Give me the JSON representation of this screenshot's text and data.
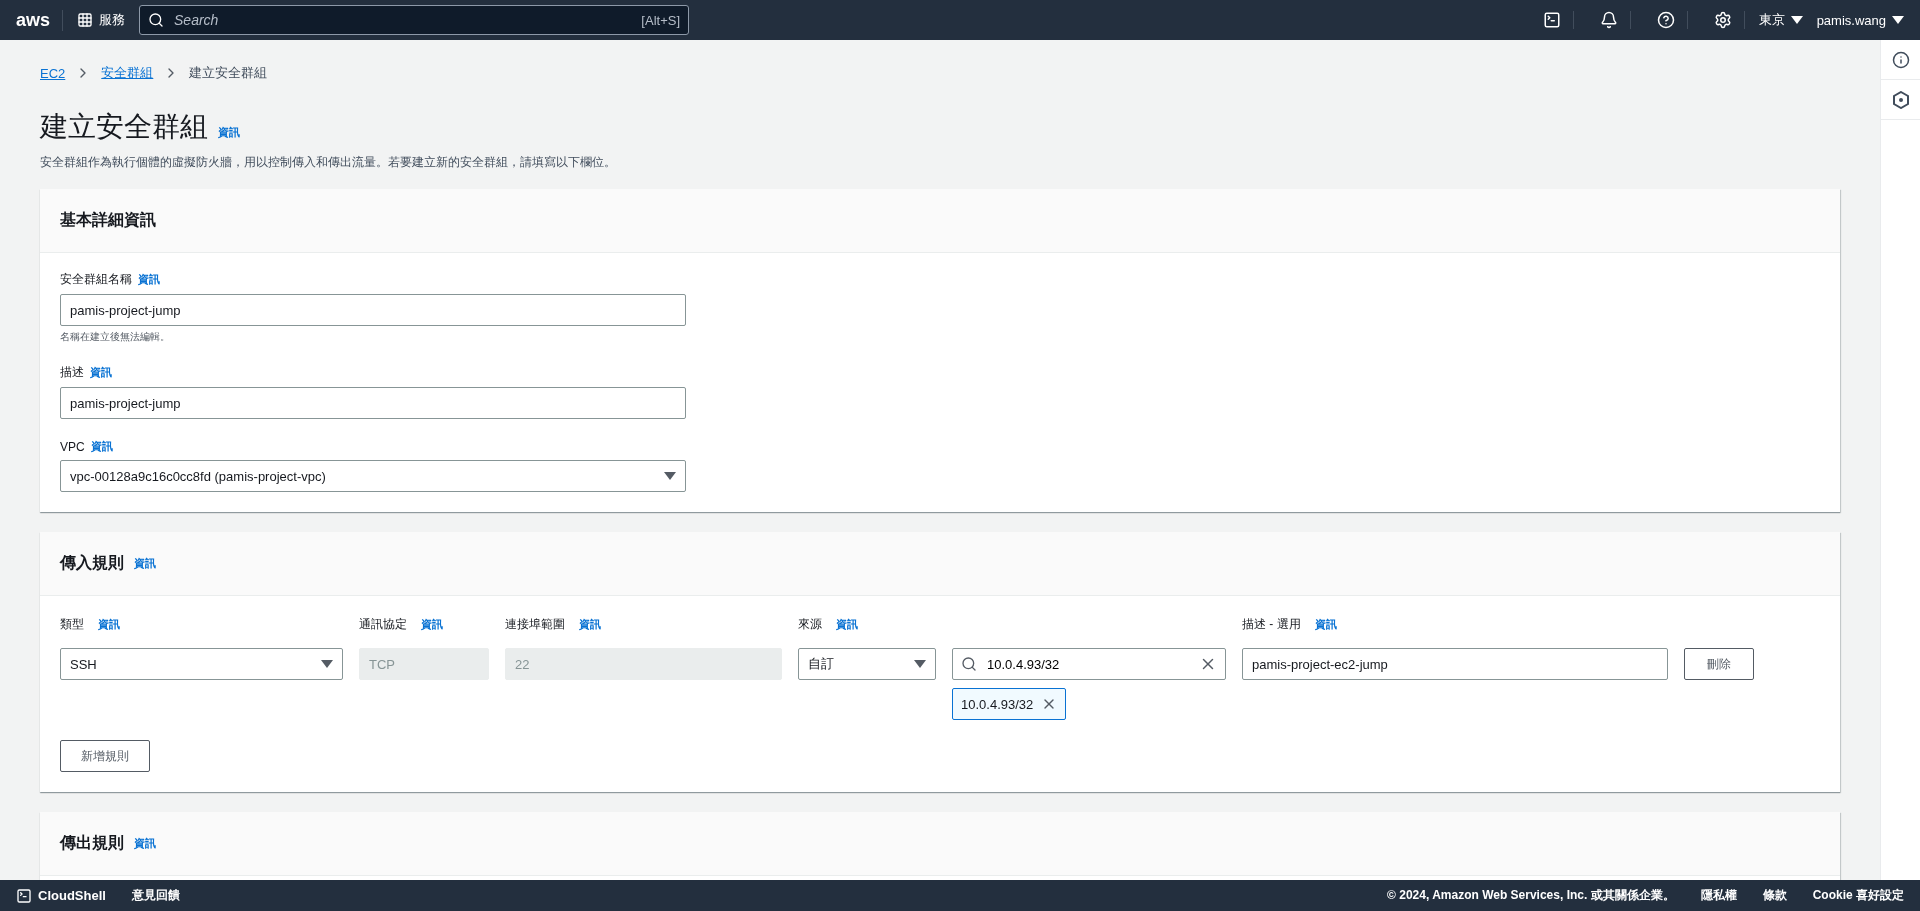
{
  "top_nav": {
    "logo": "aws",
    "services": "服務",
    "search_placeholder": "Search",
    "search_shortcut": "[Alt+S]",
    "region": "東京",
    "user": "pamis.wang"
  },
  "breadcrumbs": [
    {
      "label": "EC2",
      "link": true
    },
    {
      "label": "安全群組",
      "link": true
    },
    {
      "label": "建立安全群組",
      "link": false
    }
  ],
  "page": {
    "title": "建立安全群組",
    "info": "資訊",
    "description": "安全群組作為執行個體的虛擬防火牆，用以控制傳入和傳出流量。若要建立新的安全群組，請填寫以下欄位。"
  },
  "basic_details": {
    "title": "基本詳細資訊",
    "fields": [
      {
        "kind": "input",
        "label": "安全群組名稱",
        "info": "資訊",
        "value": "pamis-project-jump",
        "hint": "名稱在建立後無法編輯。"
      },
      {
        "kind": "input",
        "label": "描述",
        "info": "資訊",
        "value": "pamis-project-jump"
      },
      {
        "kind": "select",
        "label": "VPC",
        "info": "資訊",
        "value": "vpc-00128a9c16c0cc8fd (pamis-project-vpc)"
      }
    ]
  },
  "inbound_rules": {
    "title": "傳入規則",
    "info": "資訊",
    "columns": [
      {
        "label": "類型",
        "info": "資訊"
      },
      {
        "label": "通訊協定",
        "info": "資訊"
      },
      {
        "label": "連接埠範圍",
        "info": "資訊"
      },
      {
        "label": "來源",
        "info": "資訊"
      },
      {
        "label": "描述 - 選用",
        "info": "資訊"
      }
    ],
    "rows": [
      {
        "type": "SSH",
        "protocol": "TCP",
        "port_range": "22",
        "source": "自訂",
        "cidr_search": "10.0.4.93/32",
        "tokens": [
          "10.0.4.93/32"
        ],
        "description": "pamis-project-ec2-jump",
        "delete": "刪除"
      }
    ],
    "add_button": "新增規則"
  },
  "outbound_rules": {
    "title": "傳出規則",
    "info": "資訊"
  },
  "footer": {
    "cloudshell": "CloudShell",
    "feedback": "意見回饋",
    "copyright": "© 2024, Amazon Web Services, Inc. 或其關係企業。",
    "links": [
      "隱私權",
      "條款",
      "Cookie 喜好設定"
    ]
  }
}
